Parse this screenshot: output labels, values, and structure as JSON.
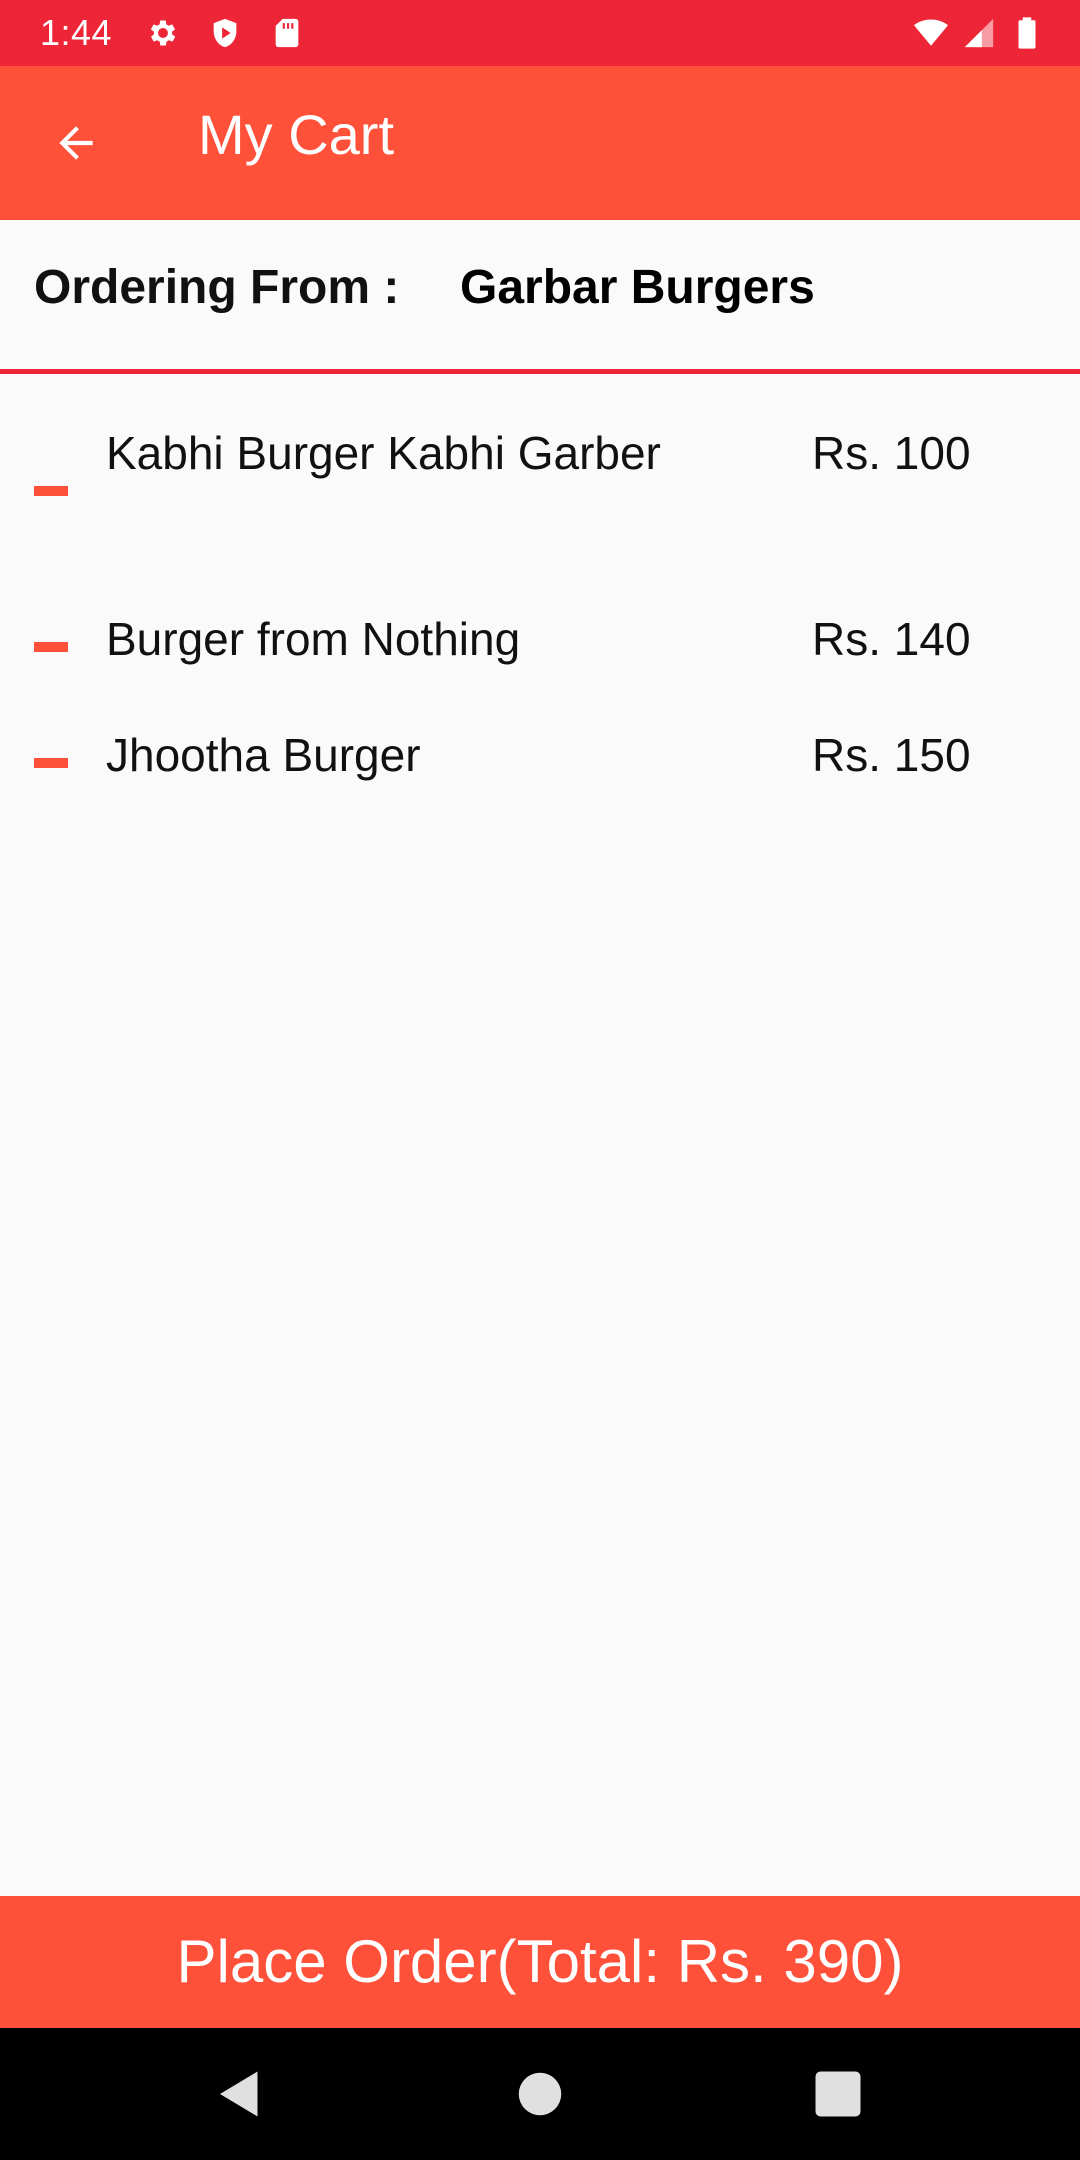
{
  "status_bar": {
    "time": "1:44",
    "icons": [
      "gear-icon",
      "shield-icon",
      "sd-card-icon",
      "wifi-icon",
      "signal-icon",
      "battery-icon"
    ]
  },
  "app_bar": {
    "title": "My Cart",
    "back_icon": "arrow-left-icon"
  },
  "ordering": {
    "label": "Ordering From :",
    "restaurant": "Garbar Burgers"
  },
  "cart": {
    "items": [
      {
        "name": "Kabhi Burger Kabhi Garber",
        "price": "Rs. 100"
      },
      {
        "name": "Burger from Nothing",
        "price": "Rs. 140"
      },
      {
        "name": "Jhootha Burger",
        "price": "Rs. 150"
      }
    ]
  },
  "place_order": {
    "label": "Place Order(Total: Rs. 390)"
  },
  "nav_bar": {
    "icons": [
      "back-triangle-icon",
      "home-circle-icon",
      "recents-square-icon"
    ]
  },
  "colors": {
    "status_bar": "#ee2536",
    "accent": "#ff5039",
    "background": "#fafafa",
    "divider": "#ee2536"
  }
}
